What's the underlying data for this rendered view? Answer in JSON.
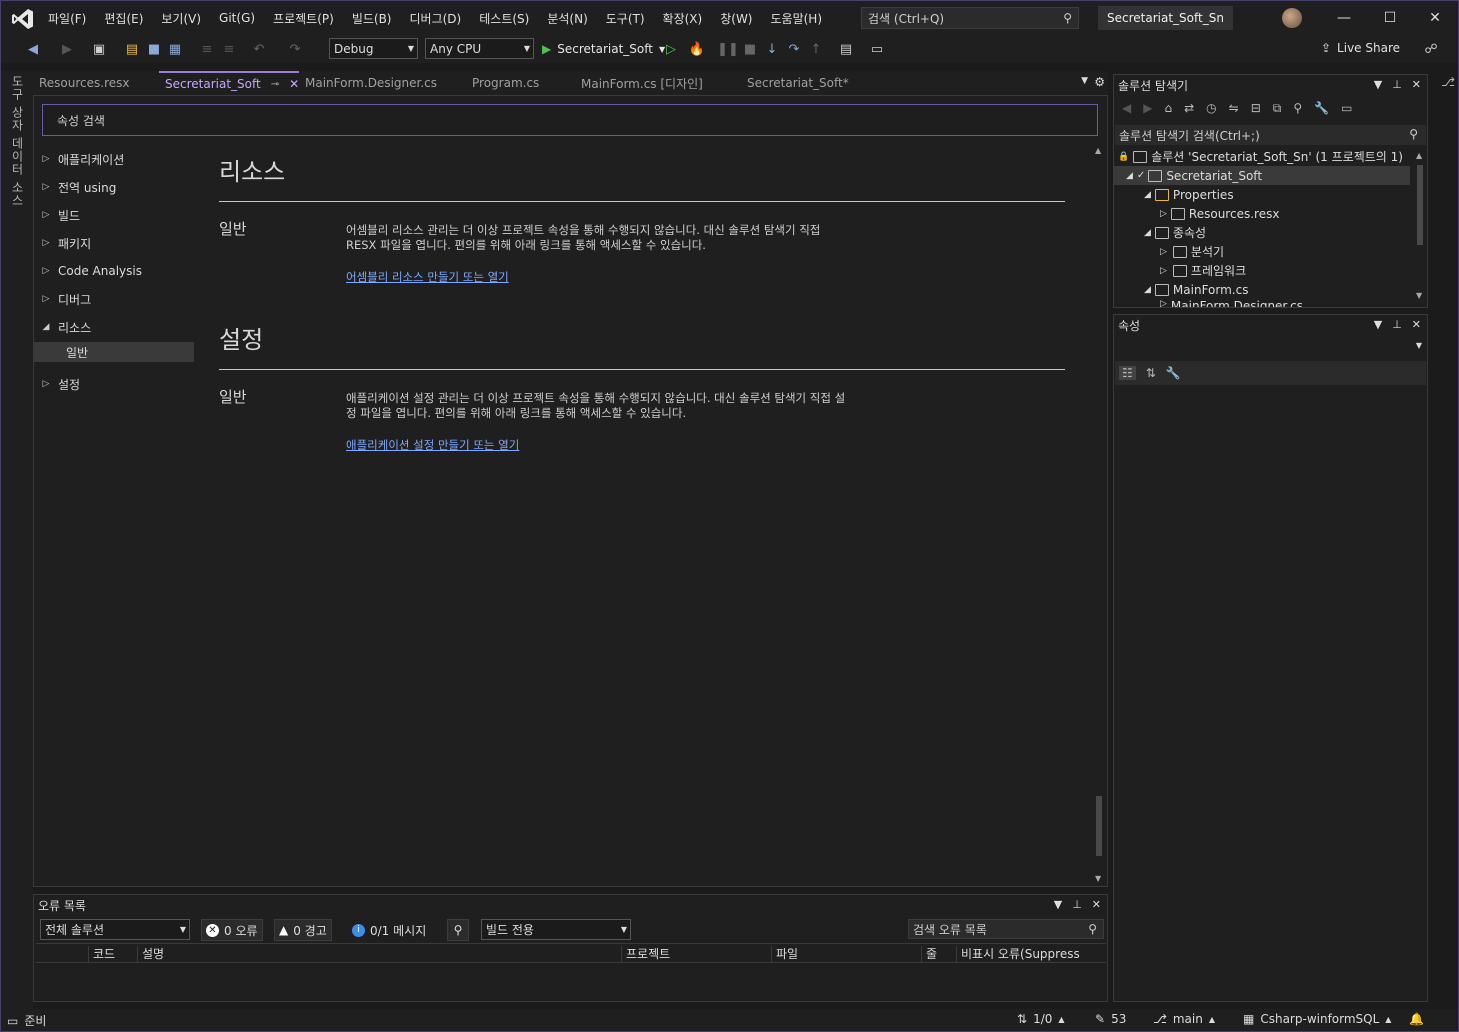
{
  "titlebar": {
    "menu": [
      "파일(F)",
      "편집(E)",
      "보기(V)",
      "Git(G)",
      "프로젝트(P)",
      "빌드(B)",
      "디버그(D)",
      "테스트(S)",
      "분석(N)",
      "도구(T)",
      "확장(X)",
      "창(W)",
      "도움말(H)"
    ],
    "search_placeholder": "검색 (Ctrl+Q)",
    "solution_name": "Secretariat_Soft_Sn"
  },
  "toolbar": {
    "config": "Debug",
    "platform": "Any CPU",
    "run_label": "Secretariat_Soft",
    "live_share": "Live Share"
  },
  "left_strip": {
    "items": [
      "도구 상자",
      "데이터 소스"
    ]
  },
  "tabs": [
    {
      "label": "Resources.resx"
    },
    {
      "label": "Secretariat_Soft"
    },
    {
      "label": "MainForm.Designer.cs"
    },
    {
      "label": "Program.cs"
    },
    {
      "label": "MainForm.cs [디자인]"
    },
    {
      "label": "Secretariat_Soft*"
    }
  ],
  "props_page": {
    "search_placeholder": "속성 검색",
    "nav": [
      "애플리케이션",
      "전역 using",
      "빌드",
      "패키지",
      "Code Analysis",
      "디버그",
      "리소스",
      "일반",
      "설정"
    ],
    "resources": {
      "title": "리소스",
      "sub": "일반",
      "desc": "어셈블리 리소스 관리는 더 이상 프로젝트 속성을 통해 수행되지 않습니다. 대신 솔루션 탐색기 직접 RESX 파일을 엽니다. 편의를 위해 아래 링크를 통해 액세스할 수 있습니다.",
      "link": "어셈블리 리소스 만들기 또는 열기"
    },
    "settings": {
      "title": "설정",
      "sub": "일반",
      "desc": "애플리케이션 설정 관리는 더 이상 프로젝트 속성을 통해 수행되지 않습니다. 대신 솔루션 탐색기 직접 설정 파일을 엽니다. 편의를 위해 아래 링크를 통해 액세스할 수 있습니다.",
      "link": "애플리케이션 설정 만들기 또는 열기"
    }
  },
  "error_list": {
    "title": "오류 목록",
    "scope": "전체 솔루션",
    "errors": "0 오류",
    "warnings": "0 경고",
    "messages": "0/1 메시지",
    "build_filter": "빌드 전용",
    "search_placeholder": "검색 오류 목록",
    "columns": [
      "코드",
      "설명",
      "프로젝트",
      "파일",
      "줄",
      "비표시 오류(Suppress"
    ]
  },
  "solution_explorer": {
    "title": "솔루션 탐색기",
    "search_placeholder": "솔루션 탐색기 검색(Ctrl+;)",
    "tree": [
      "솔루션 'Secretariat_Soft_Sn' (1 프로젝트의 1)",
      "Secretariat_Soft",
      "Properties",
      "Resources.resx",
      "종속성",
      "분석기",
      "프레임워크",
      "MainForm.cs",
      "MainForm.Designer.cs"
    ]
  },
  "properties": {
    "title": "속성"
  },
  "statusbar": {
    "ready": "준비",
    "line_info": "1/0",
    "changes": "53",
    "branch": "main",
    "repo": "Csharp-winformSQL"
  }
}
